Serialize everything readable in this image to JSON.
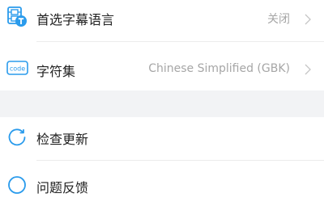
{
  "settings": {
    "subtitle_language": {
      "label": "首选字幕语言",
      "value": "关闭",
      "icon": "subtitle-film-icon"
    },
    "charset": {
      "label": "字符集",
      "value": "Chinese Simplified (GBK)",
      "icon": "code-icon",
      "icon_text": "code"
    },
    "check_update": {
      "label": "检查更新",
      "icon": "refresh-icon"
    },
    "partial_item": {
      "label": "问题反馈",
      "icon": "feedback-icon"
    }
  },
  "colors": {
    "accent": "#2a9bec",
    "text": "#222222",
    "secondary_text": "#a6a6a6",
    "section_background": "#f2f3f5"
  }
}
